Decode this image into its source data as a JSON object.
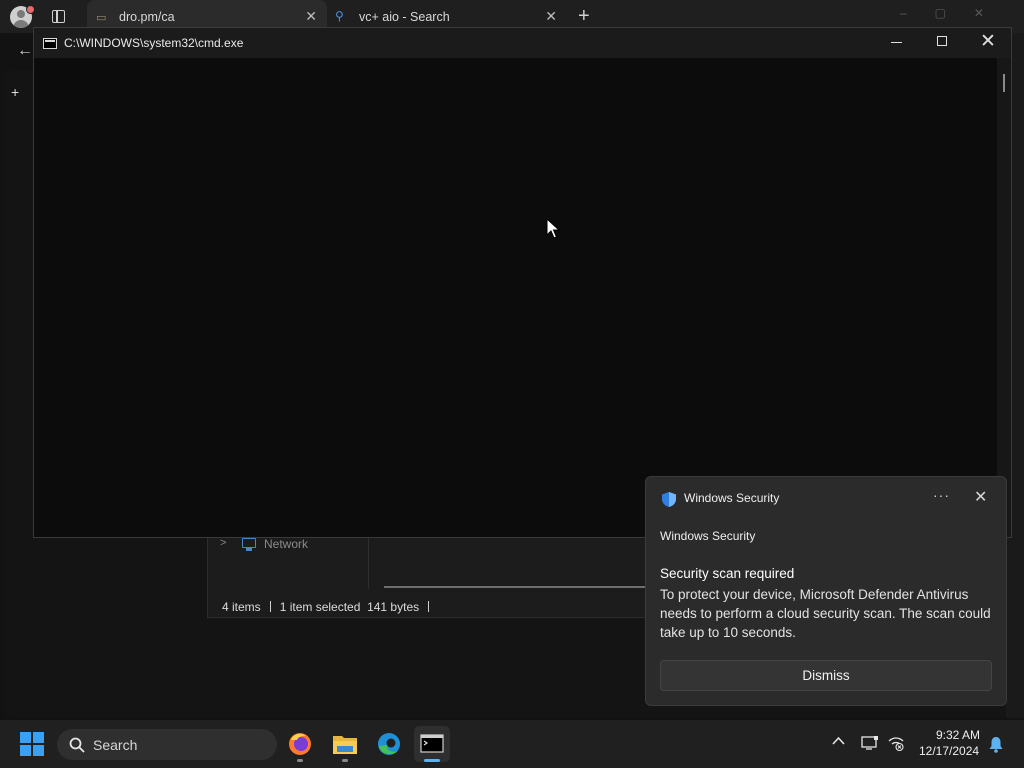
{
  "browser": {
    "tabs": [
      {
        "title": "dro.pm/ca",
        "active": true
      },
      {
        "title": "vc+ aio - Search",
        "active": false
      }
    ],
    "new_tab_symbol": "+",
    "back_symbol": "←",
    "side_plus": "+",
    "close_symbol": "✕"
  },
  "explorer": {
    "nav_item": "Network",
    "status": {
      "items": "4 items",
      "selected": "1 item selected",
      "size": "141 bytes"
    }
  },
  "cmd": {
    "title": "C:\\WINDOWS\\system32\\cmd.exe",
    "close_symbol": "✕"
  },
  "toast": {
    "app_name": "Windows Security",
    "heading": "Windows Security",
    "title": "Security scan required",
    "body": "To protect your device, Microsoft Defender Antivirus needs to perform a cloud security scan. The scan could take up to 10 seconds.",
    "more_symbol": "···",
    "close_symbol": "✕",
    "dismiss_label": "Dismiss"
  },
  "taskbar": {
    "search_label": "Search",
    "apps": [
      "firefox-icon",
      "file-explorer-icon",
      "edge-icon",
      "terminal-icon"
    ],
    "clock": {
      "time": "9:32 AM",
      "date": "12/17/2024"
    },
    "accent": "#3aa0f3"
  }
}
